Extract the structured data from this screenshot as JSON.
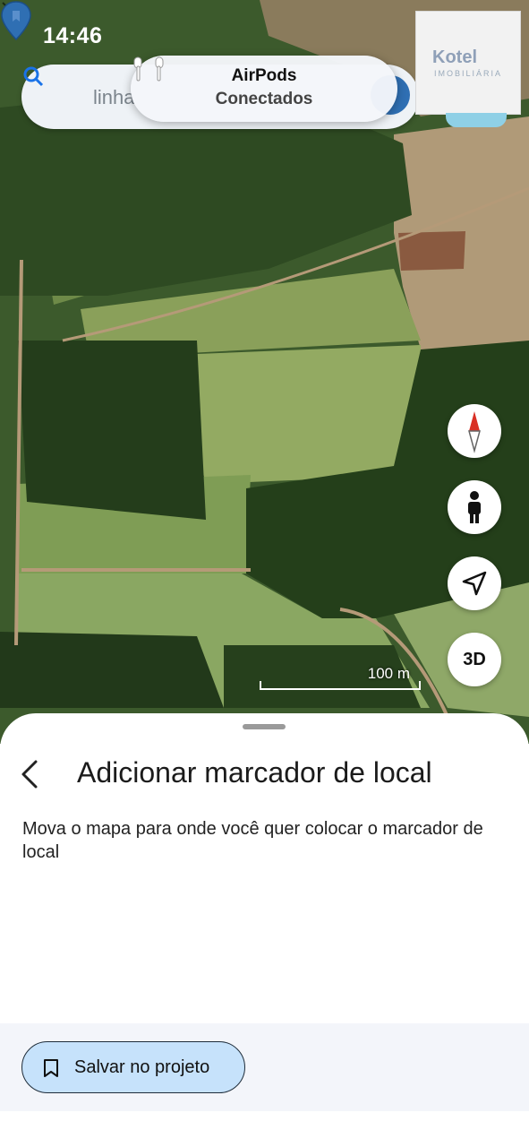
{
  "status_bar": {
    "time": "14:46"
  },
  "search": {
    "text": "linha"
  },
  "airpods": {
    "title": "AirPods",
    "subtitle": "Conectados"
  },
  "thumbnail": {
    "logo": "Kotel",
    "sub": "IMOBILIÁRIA"
  },
  "map": {
    "scale_label": "100 m"
  },
  "controls": {
    "threed_label": "3D"
  },
  "sheet": {
    "title": "Adicionar marcador de local",
    "description": "Mova o mapa para onde você quer colocar o marcador de local"
  },
  "footer": {
    "save_label": "Salvar no projeto"
  },
  "colors": {
    "accent": "#c6e2fb",
    "pin": "#2f6fb3",
    "compass_red": "#d93025"
  },
  "icons": [
    "bell-off-icon",
    "search-icon",
    "airpods-icon",
    "compass-icon",
    "street-view-icon",
    "navigation-icon",
    "map-pin-icon",
    "back-arrow-icon",
    "bookmark-icon"
  ]
}
